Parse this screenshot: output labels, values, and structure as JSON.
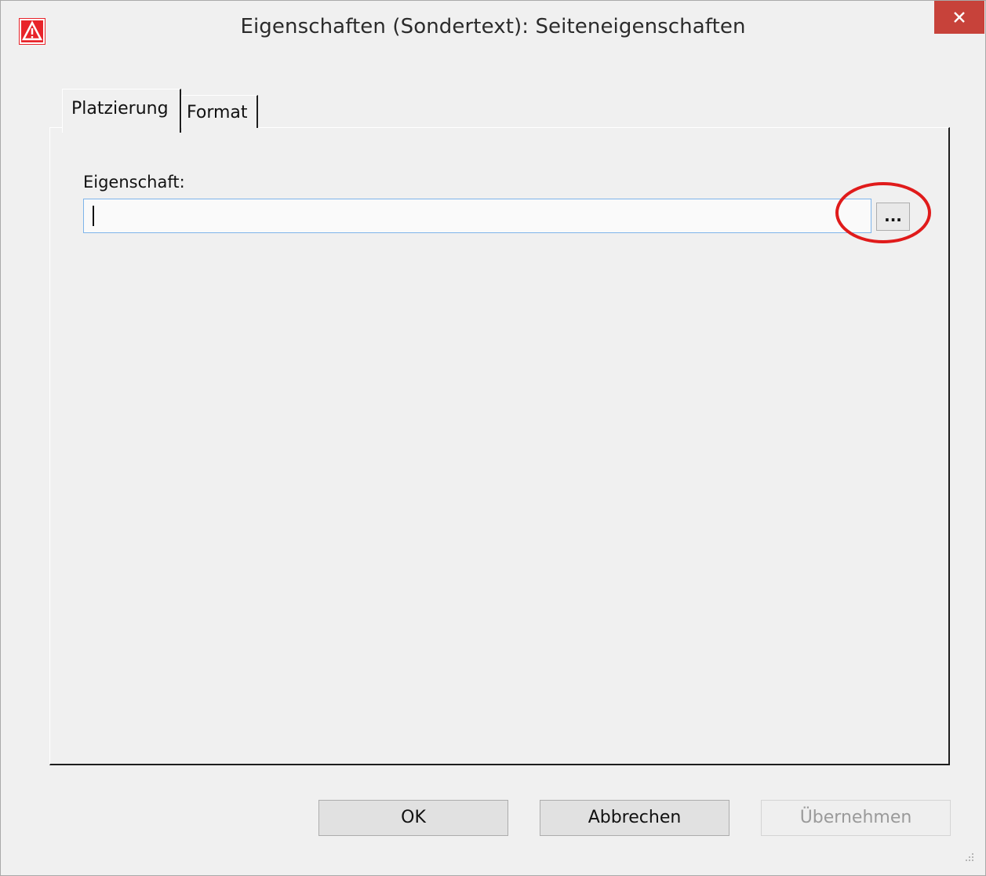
{
  "window": {
    "title": "Eigenschaften (Sondertext): Seiteneigenschaften",
    "app_icon": "warning-triangle-icon",
    "close_icon": "close-icon",
    "accent_color": "#c7423a"
  },
  "tabs": [
    {
      "label": "Platzierung",
      "active": true
    },
    {
      "label": "Format",
      "active": false
    }
  ],
  "form": {
    "property_label": "Eigenschaft:",
    "property_value": "",
    "browse_button_label": "...",
    "highlight_color": "#e01b1b"
  },
  "buttons": {
    "ok": "OK",
    "cancel": "Abbrechen",
    "apply": "Übernehmen",
    "apply_enabled": false
  }
}
